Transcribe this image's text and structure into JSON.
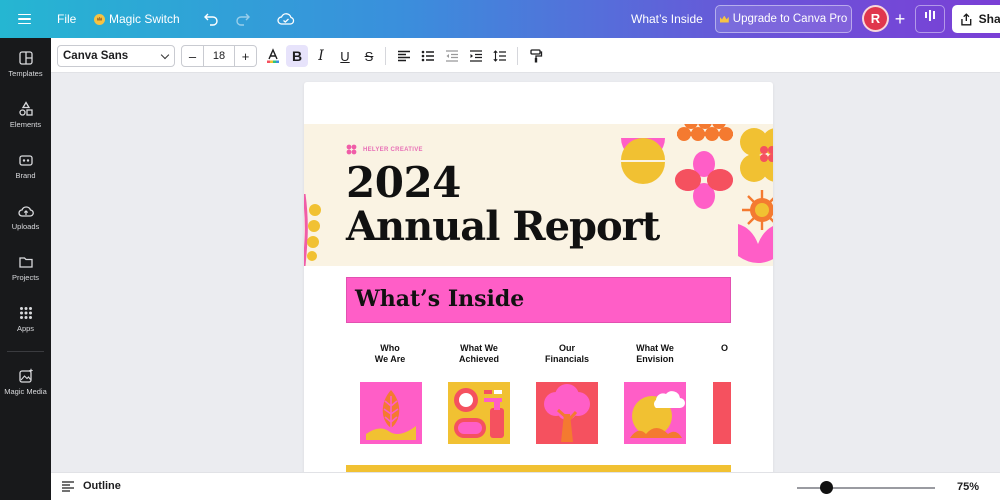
{
  "topbar": {
    "file_label": "File",
    "magic_switch_label": "Magic Switch",
    "doc_title": "What’s Inside",
    "upgrade_label": "Upgrade to Canva Pro",
    "avatar_initial": "R",
    "share_label": "Share"
  },
  "rail": {
    "items": [
      {
        "label": "Templates",
        "icon": "templates-icon"
      },
      {
        "label": "Elements",
        "icon": "elements-icon"
      },
      {
        "label": "Brand",
        "icon": "brand-icon"
      },
      {
        "label": "Uploads",
        "icon": "uploads-icon"
      },
      {
        "label": "Projects",
        "icon": "projects-icon"
      },
      {
        "label": "Apps",
        "icon": "apps-icon"
      },
      {
        "label": "Magic Media",
        "icon": "magic-media-icon"
      }
    ]
  },
  "toolbar": {
    "font_family": "Canva Sans",
    "font_size": "18",
    "minus": "–",
    "plus": "+"
  },
  "design": {
    "brand_name": "HELYER CREATIVE",
    "year": "2024",
    "title": "Annual Report",
    "inside_heading": "What’s Inside",
    "sections": [
      {
        "line1": "Who",
        "line2": "We Are"
      },
      {
        "line1": "What We",
        "line2": "Achieved"
      },
      {
        "line1": "Our",
        "line2": "Financials"
      },
      {
        "line1": "What We",
        "line2": "Envision"
      },
      {
        "line1": "O",
        "line2": ""
      }
    ],
    "colors": {
      "pink": "#ff5ec7",
      "yellow": "#f1c132",
      "red": "#f5515f",
      "cream": "#faf3e3",
      "orange": "#f47a30"
    }
  },
  "statusbar": {
    "outline_label": "Outline",
    "zoom_label": "75%"
  }
}
